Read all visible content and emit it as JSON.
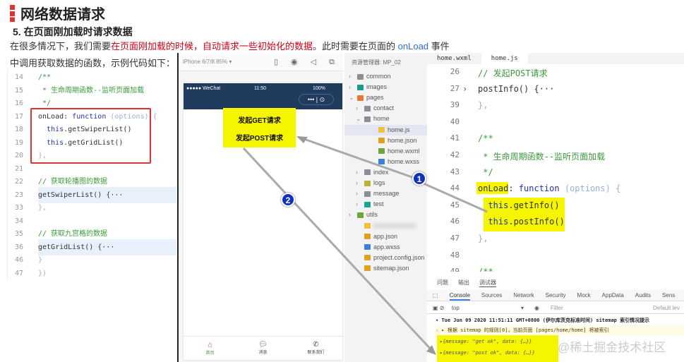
{
  "header": {
    "title": "网络数据请求",
    "subtitle": "5. 在页面刚加载时请求数据",
    "intro_a": "在很多情况下，我们需要",
    "intro_red": "在页面刚加载的时候，自动请求一些初始化的数据",
    "intro_b": "。此时需要在页面的 ",
    "intro_blue": "onLoad",
    "intro_c": " 事件",
    "intro2": "中调用获取数据的函数，示例代码如下："
  },
  "left_code": [
    {
      "n": "14",
      "t": "/**",
      "c": "cm"
    },
    {
      "n": "15",
      "t": " * 生命周期函数--监听页面加载",
      "c": "cm"
    },
    {
      "n": "16",
      "t": " */",
      "c": "cm"
    },
    {
      "n": "17",
      "t": "onLoad: function (options) {",
      "c": ""
    },
    {
      "n": "18",
      "t": "  this.getSwiperList()",
      "c": ""
    },
    {
      "n": "19",
      "t": "  this.getGridList()",
      "c": ""
    },
    {
      "n": "20",
      "t": "},",
      "c": "pl"
    },
    {
      "n": "21",
      "t": "",
      "c": ""
    },
    {
      "n": "22",
      "t": "// 获取轮播图的数据",
      "c": "cm"
    },
    {
      "n": "23",
      "t": "getSwiperList() {···",
      "c": "hl"
    },
    {
      "n": "33",
      "t": "},",
      "c": "pl"
    },
    {
      "n": "34",
      "t": "",
      "c": ""
    },
    {
      "n": "35",
      "t": "// 获取九宫格的数据",
      "c": "cm"
    },
    {
      "n": "36",
      "t": "getGridList() {···",
      "c": "hl"
    },
    {
      "n": "46",
      "t": "}",
      "c": "pl"
    },
    {
      "n": "47",
      "t": "})",
      "c": "pl"
    }
  ],
  "simulator": {
    "device": "iPhone 6/7/8 85% ▾",
    "carrier": "●●●●● WeChat",
    "time": "11:50",
    "battery": "100%",
    "btn_get": "发起GET请求",
    "btn_post": "发起POST请求",
    "tabs": [
      "首页",
      "消息",
      "联系我们"
    ],
    "tab_active_color": "#e4502e"
  },
  "explorer": {
    "title": "资源管理器: MP_02",
    "items": [
      {
        "label": "common",
        "icon": "folder",
        "depth": 1,
        "arrow": ">"
      },
      {
        "label": "images",
        "icon": "folder-images",
        "depth": 1,
        "arrow": ">"
      },
      {
        "label": "pages",
        "icon": "folder-pages",
        "depth": 1,
        "arrow": "v"
      },
      {
        "label": "contact",
        "icon": "folder",
        "depth": 2,
        "arrow": ">"
      },
      {
        "label": "home",
        "icon": "folder-open",
        "depth": 2,
        "arrow": "v"
      },
      {
        "label": "home.js",
        "icon": "js",
        "depth": 3,
        "arrow": ""
      },
      {
        "label": "home.json",
        "icon": "json",
        "depth": 3,
        "arrow": ""
      },
      {
        "label": "home.wxml",
        "icon": "wxml",
        "depth": 3,
        "arrow": ""
      },
      {
        "label": "home.wxss",
        "icon": "wxss",
        "depth": 3,
        "arrow": ""
      },
      {
        "label": "index",
        "icon": "folder",
        "depth": 2,
        "arrow": ">"
      },
      {
        "label": "logs",
        "icon": "folder-logs",
        "depth": 2,
        "arrow": ">"
      },
      {
        "label": "message",
        "icon": "folder",
        "depth": 2,
        "arrow": ">"
      },
      {
        "label": "test",
        "icon": "folder-test",
        "depth": 2,
        "arrow": ">"
      },
      {
        "label": "utils",
        "icon": "folder-utils",
        "depth": 1,
        "arrow": ">"
      },
      {
        "label": "",
        "icon": "js",
        "depth": 1,
        "arrow": ""
      },
      {
        "label": "app.json",
        "icon": "json",
        "depth": 1,
        "arrow": ""
      },
      {
        "label": "app.wxss",
        "icon": "wxss",
        "depth": 1,
        "arrow": ""
      },
      {
        "label": "project.config.json",
        "icon": "json",
        "depth": 1,
        "arrow": ""
      },
      {
        "label": "sitemap.json",
        "icon": "json",
        "depth": 1,
        "arrow": ""
      }
    ]
  },
  "editor": {
    "tabs": [
      "home.wxml",
      "home.js"
    ],
    "lines": [
      {
        "n": "26",
        "t": "// 发起POST请求",
        "c": "cm"
      },
      {
        "n": "27",
        "t": "postInfo() {···",
        "c": "fold"
      },
      {
        "n": "39",
        "t": "},",
        "c": "pl"
      },
      {
        "n": "40",
        "t": "",
        "c": ""
      },
      {
        "n": "41",
        "t": "/**",
        "c": "cm"
      },
      {
        "n": "42",
        "t": " * 生命周期函数--监听页面加载",
        "c": "cm"
      },
      {
        "n": "43",
        "t": " */",
        "c": "cm"
      },
      {
        "n": "44",
        "t": "onLoad: function (options) {",
        "c": ""
      },
      {
        "n": "45",
        "t": "  this.getInfo()",
        "c": ""
      },
      {
        "n": "46",
        "t": "  this.postInfo()",
        "c": ""
      },
      {
        "n": "47",
        "t": "},",
        "c": "pl"
      },
      {
        "n": "48",
        "t": "",
        "c": ""
      },
      {
        "n": "49",
        "t": "/**",
        "c": "cm"
      }
    ]
  },
  "console": {
    "panel_tabs": [
      "问题",
      "输出",
      "调试器"
    ],
    "tabs": [
      "Console",
      "Sources",
      "Network",
      "Security",
      "Mock",
      "AppData",
      "Audits",
      "Sens"
    ],
    "context": "top",
    "filter_placeholder": "Filter",
    "levels": "Default lev",
    "log_header": "Tue Jun 09 2020 11:51:11 GMT+0800 (伊尔库茨克标准时间) sitemap 索引情况提示",
    "warning": "根据 sitemap 的规则[0]，当前页面 [pages/home/home] 将被索引",
    "out1": "{message: \"get ok\", data: {…}}",
    "out2": "{message: \"post ok\", data: {…}}"
  },
  "annotations": {
    "badge1": "1",
    "badge2": "2"
  },
  "watermark": "@稀土掘金技术社区"
}
